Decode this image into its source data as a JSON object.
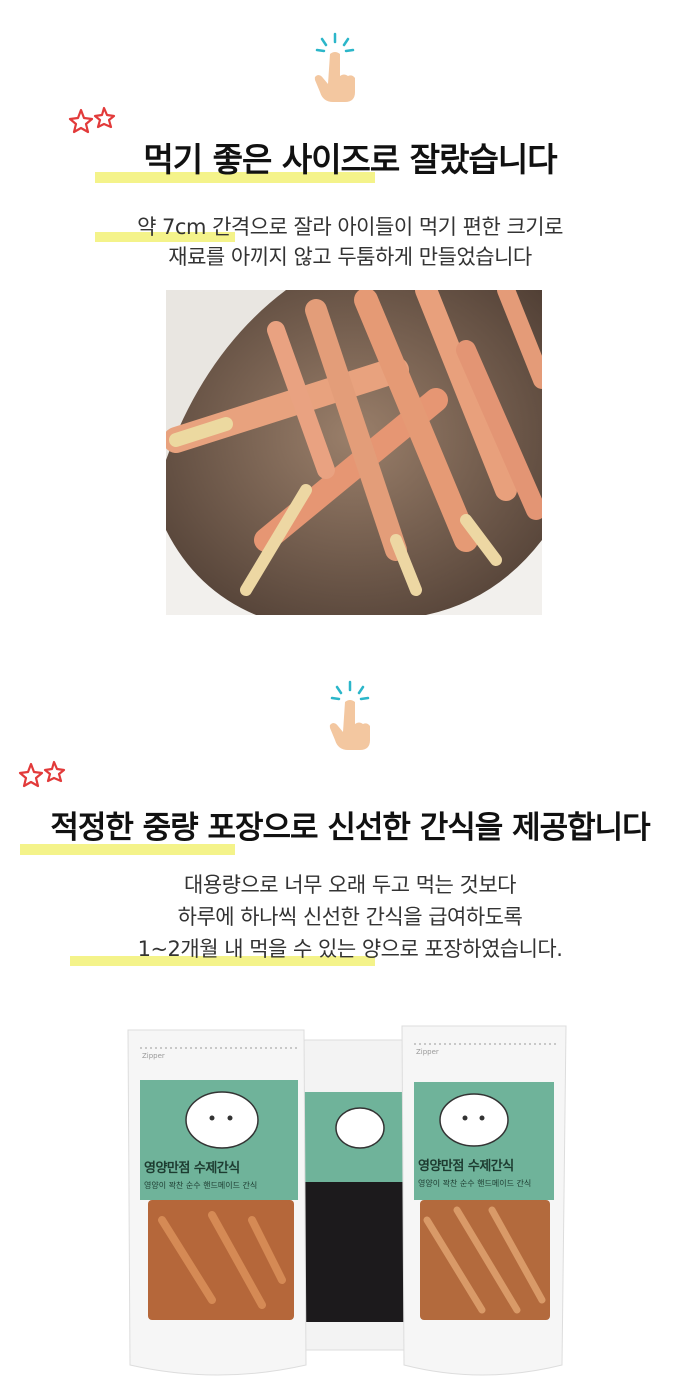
{
  "section1": {
    "title": "먹기 좋은 사이즈로 잘랐습니다",
    "lines": [
      "약 7cm 간격으로 잘라 아이들이 먹기 편한 크기로",
      "재료를 아끼지 않고 두툼하게 만들었습니다"
    ]
  },
  "section2": {
    "title": "적정한 중량 포장으로 신선한 간식을 제공합니다",
    "lines": [
      "대용량으로 너무 오래 두고 먹는 것보다",
      "하루에 하나씩 신선한 간식을 급여하도록",
      "1~2개월 내 먹을 수 있는 양으로 포장하였습니다."
    ]
  },
  "package": {
    "brand": "영양만점 수제간식",
    "subtitle": "영양이 꽉찬 순수 핸드메이드 간식",
    "zipper": "Zipper"
  },
  "colors": {
    "highlight": "#f4f38a",
    "label_green": "#6fb39a",
    "icon_teal": "#2bb6c9",
    "hand_skin": "#f3c7a0",
    "star_red": "#e23a3a"
  },
  "icons": [
    "pointer-hand-icon",
    "red-stars-icon"
  ]
}
